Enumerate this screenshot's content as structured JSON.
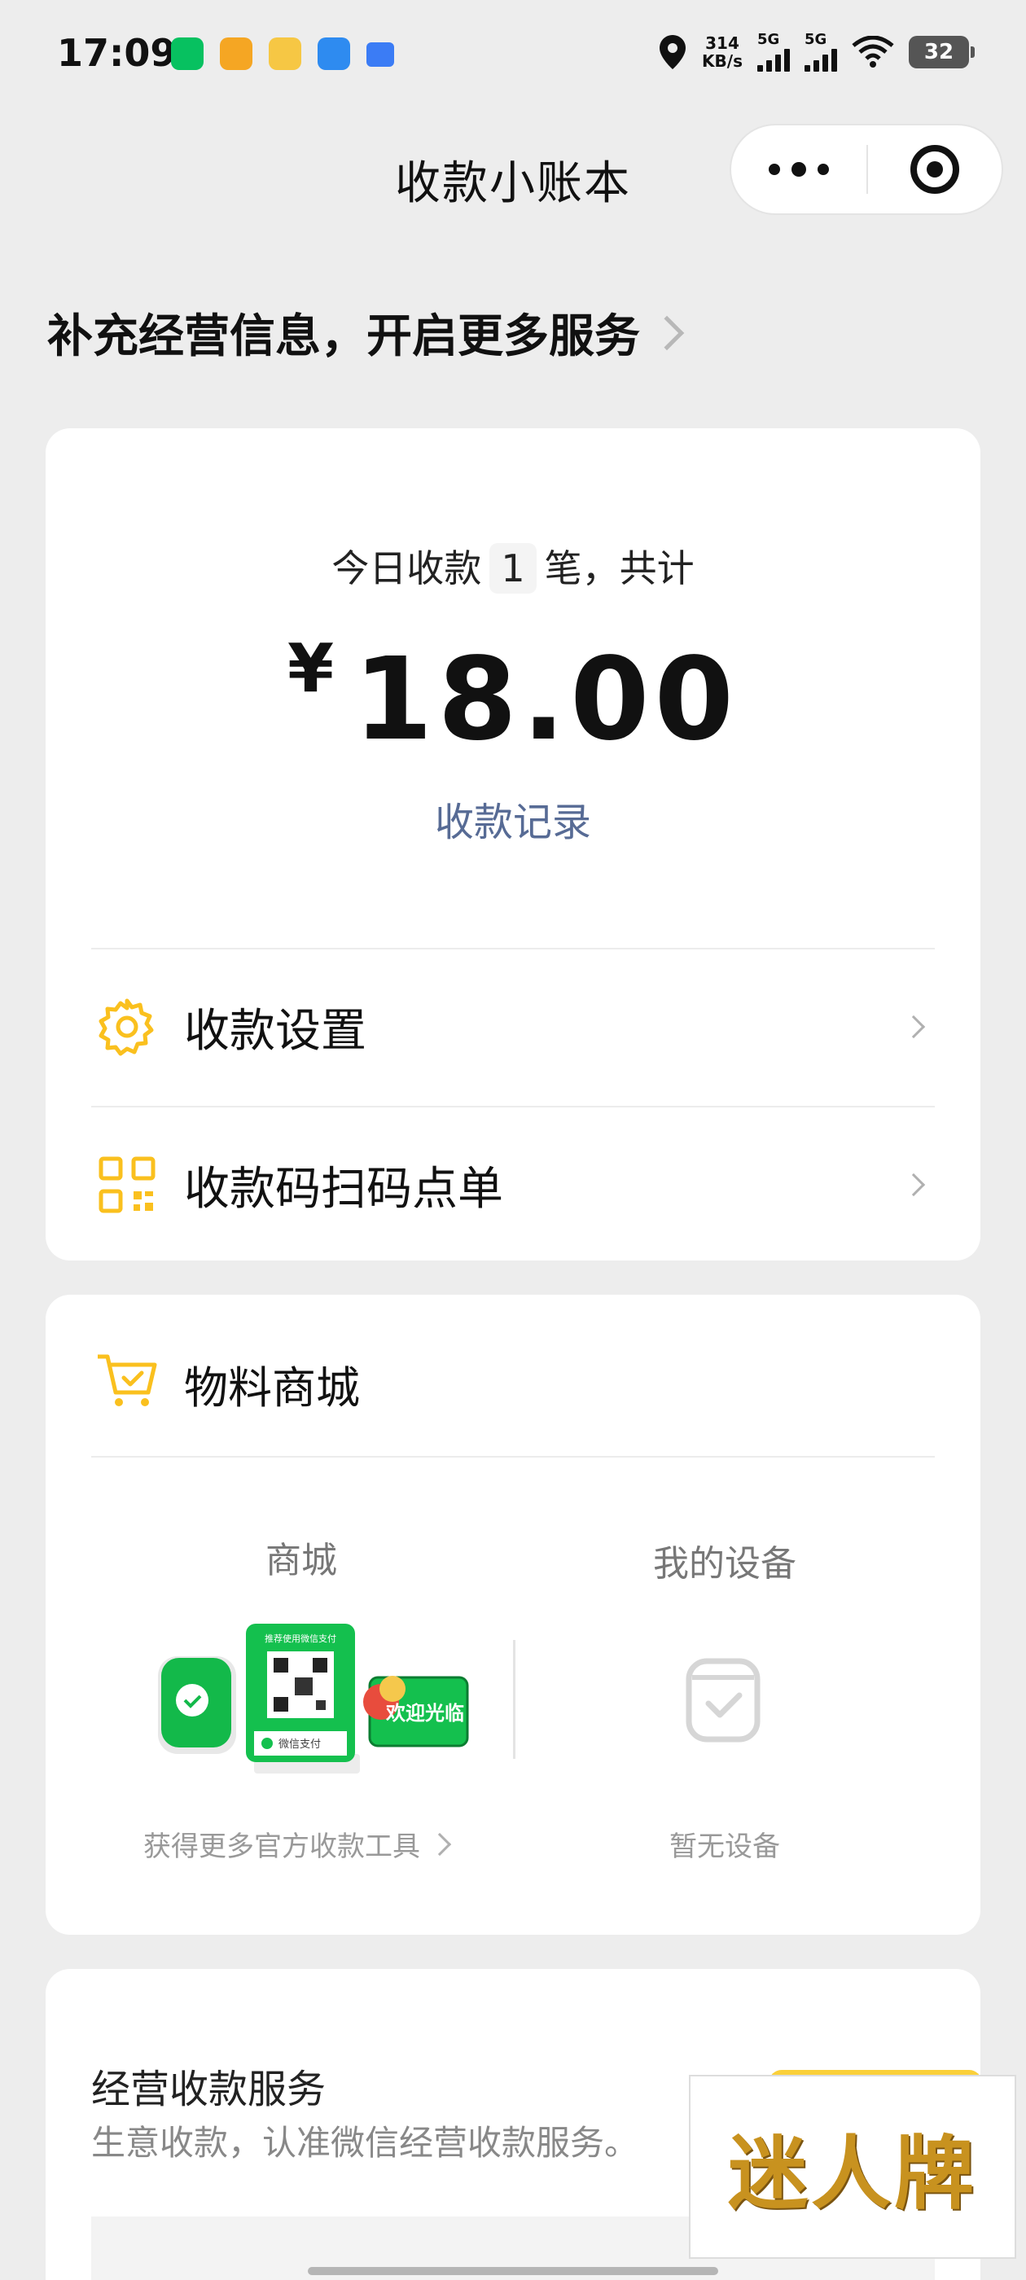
{
  "status_bar": {
    "time": "17:09",
    "speed_value": "314",
    "speed_unit": "KB/s",
    "sim1": "5G",
    "sim2": "5G",
    "battery": "32"
  },
  "nav": {
    "title": "收款小账本"
  },
  "banner": {
    "text": "补充经营信息，开启更多服务"
  },
  "summary": {
    "today_prefix": "今日收款",
    "count": "1",
    "today_suffix": "笔，共计",
    "currency": "¥",
    "amount": "18.00",
    "records_link": "收款记录"
  },
  "menu": {
    "settings": "收款设置",
    "qr_order": "收款码扫码点单"
  },
  "mall": {
    "title": "物料商城",
    "shop_label": "商城",
    "shop_sub": "获得更多官方收款工具",
    "device_label": "我的设备",
    "device_sub": "暂无设备",
    "product_badge": "欢迎光临",
    "product_pay": "微信支付",
    "product_header": "推荐使用微信支付"
  },
  "service": {
    "title": "经营收款服务",
    "subtitle": "生意收款，认准微信经营收款服务。"
  },
  "watermark": "迷人牌",
  "colors": {
    "accent_yellow": "#FAC01E",
    "link_blue": "#576B95",
    "wechat_green": "#07C160"
  }
}
